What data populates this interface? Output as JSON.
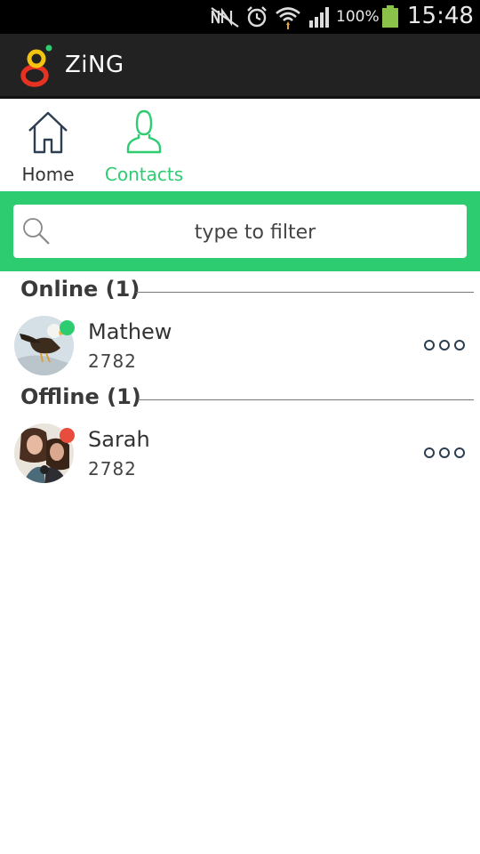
{
  "status_bar": {
    "battery_percent": "100%",
    "time": "15:48",
    "battery_color": "#8bc34a",
    "icons": [
      "nfc-icon",
      "alarm-icon",
      "wifi-icon",
      "signal-icon",
      "battery-icon"
    ]
  },
  "app_bar": {
    "title": "ZiNG",
    "logo_icon": "zing-logo"
  },
  "tabs": [
    {
      "label": "Home",
      "icon": "home-icon",
      "active": false
    },
    {
      "label": "Contacts",
      "icon": "contacts-icon",
      "active": true
    }
  ],
  "accent_color": "#2ecc71",
  "filter": {
    "placeholder": "type to filter",
    "value": ""
  },
  "sections": {
    "online": {
      "title": "Online (1)",
      "contacts": [
        {
          "name": "Mathew",
          "number": "2782",
          "status_color": "#2ecc71"
        }
      ]
    },
    "offline": {
      "title": "Offline (1)",
      "contacts": [
        {
          "name": "Sarah",
          "number": "2782",
          "status_color": "#e74c3c"
        }
      ]
    }
  }
}
